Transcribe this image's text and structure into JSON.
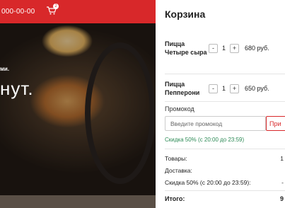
{
  "background": {
    "phone": "000-00-00",
    "cart_badge": "2",
    "text_small": "ми.",
    "text_big": "нут."
  },
  "cart": {
    "title": "Корзина",
    "items": [
      {
        "name": "Пицца Четыре сыра",
        "qty": "1",
        "price": "680 руб.",
        "minus": "-",
        "plus": "+"
      },
      {
        "name": "Пицца Пепперони",
        "qty": "1",
        "price": "650 руб.",
        "minus": "-",
        "plus": "+"
      }
    ],
    "promo": {
      "label": "Промокод",
      "placeholder": "Введите промокод",
      "button": "При"
    },
    "discount_note": "Скидка 50% (с 20:00 до 23:59)",
    "summary": [
      {
        "label": "Товары:",
        "value": "1"
      },
      {
        "label": "Доставка:",
        "value": ""
      },
      {
        "label": "Скидка 50% (с 20:00 до 23:59):",
        "value": "-"
      }
    ],
    "total": {
      "label": "Итого:",
      "value": "9"
    }
  },
  "colors": {
    "brand_red": "#d8282a",
    "discount_green": "#2e8b57"
  }
}
